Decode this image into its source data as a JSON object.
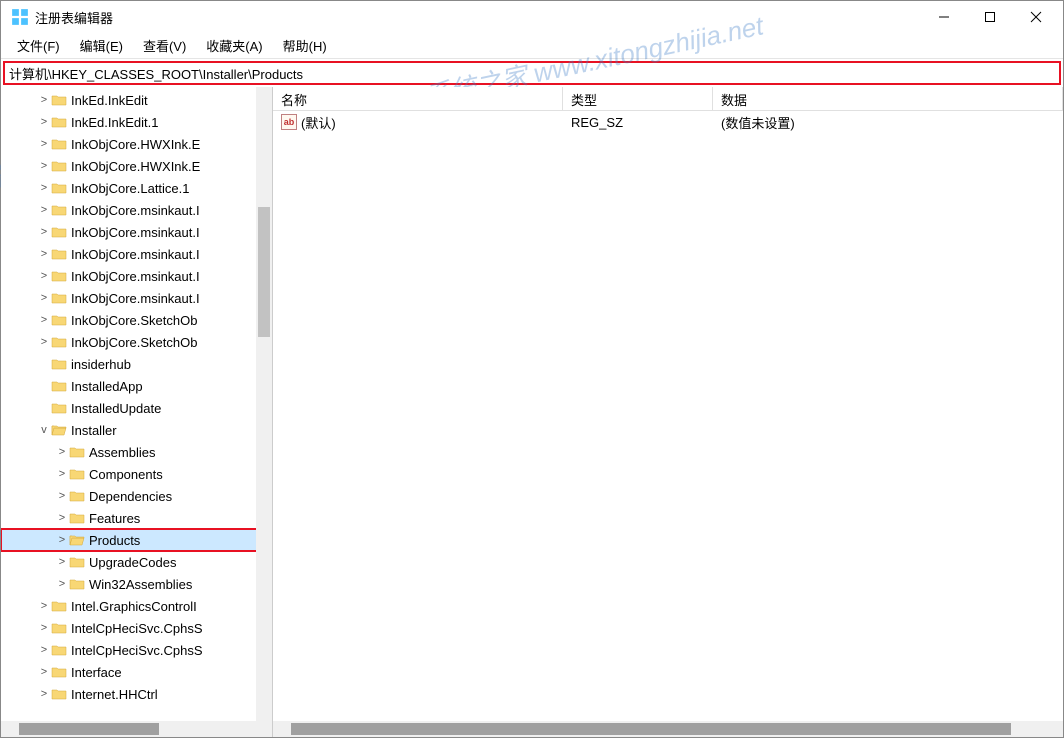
{
  "title": "注册表编辑器",
  "menus": [
    "文件(F)",
    "编辑(E)",
    "查看(V)",
    "收藏夹(A)",
    "帮助(H)"
  ],
  "address": "计算机\\HKEY_CLASSES_ROOT\\Installer\\Products",
  "tree": [
    {
      "level": 2,
      "exp": "closed",
      "label": "InkEd.InkEdit"
    },
    {
      "level": 2,
      "exp": "closed",
      "label": "InkEd.InkEdit.1"
    },
    {
      "level": 2,
      "exp": "closed",
      "label": "InkObjCore.HWXInk.E"
    },
    {
      "level": 2,
      "exp": "closed",
      "label": "InkObjCore.HWXInk.E"
    },
    {
      "level": 2,
      "exp": "closed",
      "label": "InkObjCore.Lattice.1"
    },
    {
      "level": 2,
      "exp": "closed",
      "label": "InkObjCore.msinkaut.I"
    },
    {
      "level": 2,
      "exp": "closed",
      "label": "InkObjCore.msinkaut.I"
    },
    {
      "level": 2,
      "exp": "closed",
      "label": "InkObjCore.msinkaut.I"
    },
    {
      "level": 2,
      "exp": "closed",
      "label": "InkObjCore.msinkaut.I"
    },
    {
      "level": 2,
      "exp": "closed",
      "label": "InkObjCore.msinkaut.I"
    },
    {
      "level": 2,
      "exp": "closed",
      "label": "InkObjCore.SketchOb"
    },
    {
      "level": 2,
      "exp": "closed",
      "label": "InkObjCore.SketchOb"
    },
    {
      "level": 2,
      "exp": "none",
      "label": "insiderhub"
    },
    {
      "level": 2,
      "exp": "none",
      "label": "InstalledApp"
    },
    {
      "level": 2,
      "exp": "none",
      "label": "InstalledUpdate"
    },
    {
      "level": 2,
      "exp": "open",
      "label": "Installer",
      "open": true
    },
    {
      "level": 3,
      "exp": "closed",
      "label": "Assemblies"
    },
    {
      "level": 3,
      "exp": "closed",
      "label": "Components"
    },
    {
      "level": 3,
      "exp": "closed",
      "label": "Dependencies"
    },
    {
      "level": 3,
      "exp": "closed",
      "label": "Features"
    },
    {
      "level": 3,
      "exp": "closed",
      "label": "Products",
      "selected": true,
      "highlighted": true,
      "open": true
    },
    {
      "level": 3,
      "exp": "closed",
      "label": "UpgradeCodes"
    },
    {
      "level": 3,
      "exp": "closed",
      "label": "Win32Assemblies"
    },
    {
      "level": 2,
      "exp": "closed",
      "label": "Intel.GraphicsControlI"
    },
    {
      "level": 2,
      "exp": "closed",
      "label": "IntelCpHeciSvc.CphsS"
    },
    {
      "level": 2,
      "exp": "closed",
      "label": "IntelCpHeciSvc.CphsS"
    },
    {
      "level": 2,
      "exp": "closed",
      "label": "Interface"
    },
    {
      "level": 2,
      "exp": "closed",
      "label": "Internet.HHCtrl"
    }
  ],
  "columns": {
    "name": "名称",
    "type": "类型",
    "data": "数据"
  },
  "values": [
    {
      "name": "(默认)",
      "type": "REG_SZ",
      "data": "(数值未设置)"
    }
  ],
  "watermark": "系统之家 www.xitongzhijia.net"
}
